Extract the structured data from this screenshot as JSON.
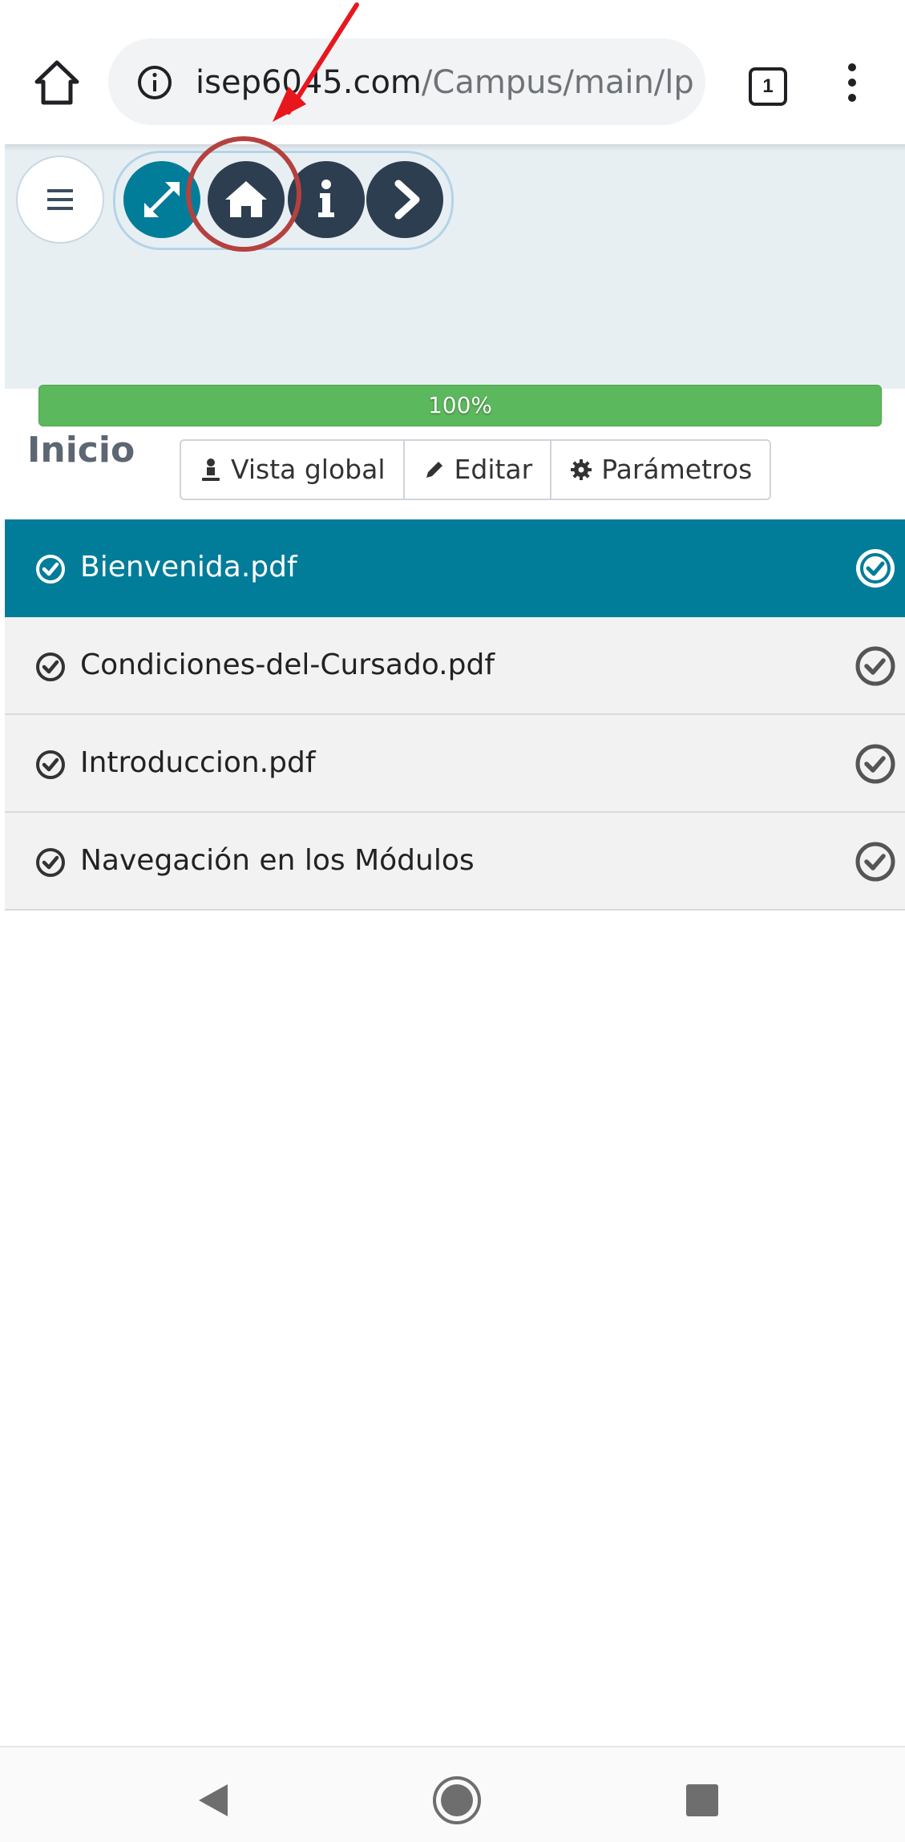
{
  "browser": {
    "url_host": "isep6045.com",
    "url_path": "/Campus/main/lp",
    "tab_count": "1",
    "icons": [
      "home-icon",
      "info-icon",
      "tabs-icon",
      "menu-dots-icon"
    ]
  },
  "toolbar": {
    "progress_percent": 100,
    "progress_label": "100%",
    "buttons": [
      {
        "label": "Vista global",
        "icon": "user-icon"
      },
      {
        "label": "Editar",
        "icon": "pencil-icon"
      },
      {
        "label": "Parámetros",
        "icon": "gear-icon"
      }
    ],
    "nav_icons": [
      "menu-icon",
      "fullscreen-icon",
      "home-icon",
      "info-icon",
      "next-icon"
    ]
  },
  "section": {
    "title": "Inicio"
  },
  "items": [
    {
      "label": "Bienvenida.pdf",
      "active": true
    },
    {
      "label": "Condiciones-del-Cursado.pdf",
      "active": false
    },
    {
      "label": "Introduccion.pdf",
      "active": false
    },
    {
      "label": "Navegación en los Módulos",
      "active": false
    }
  ],
  "colors": {
    "accent": "#027d99",
    "nav_dark": "#2c3e50",
    "progress": "#5cb85c",
    "highlight_circle": "#b5413f",
    "annotation_arrow": "#e8171e"
  }
}
